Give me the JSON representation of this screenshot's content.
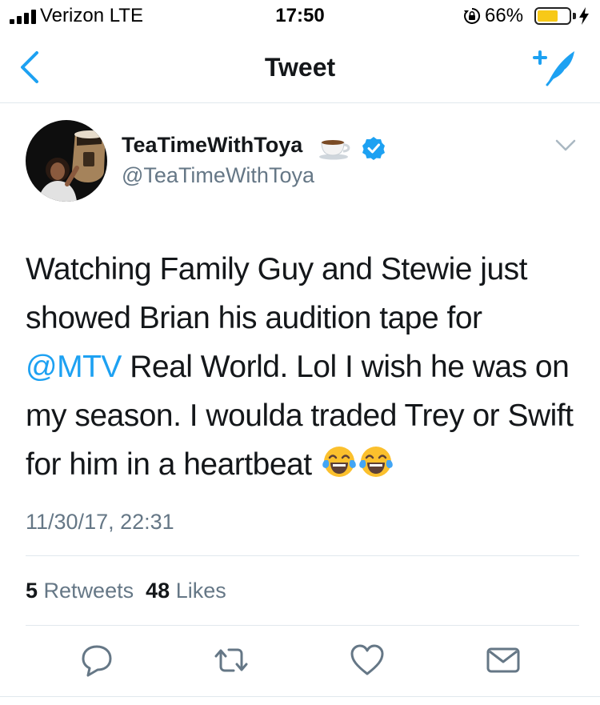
{
  "status_bar": {
    "carrier": "Verizon  LTE",
    "time": "17:50",
    "battery_percent_label": "66%",
    "battery_level": 0.66,
    "icons": [
      "signal-bars-icon",
      "orientation-lock-icon",
      "battery-icon",
      "charging-bolt-icon"
    ]
  },
  "nav": {
    "title": "Tweet",
    "icons": [
      "back-chevron-icon",
      "compose-tweet-icon"
    ]
  },
  "tweet": {
    "author": {
      "display_name": "TeaTimeWithToya",
      "handle": "@TeaTimeWithToya",
      "icons": [
        "teacup-emoji-icon",
        "verified-badge-icon",
        "chevron-down-icon"
      ]
    },
    "text": {
      "part1": "Watching Family Guy and Stewie just showed Brian his audition tape for ",
      "mention": "@MTV",
      "part2": " Real World. Lol I wish he was on my season. I woulda traded Trey or Swift for him in a heartbeat",
      "emojis": [
        "tears-of-joy-emoji",
        "tears-of-joy-emoji"
      ]
    },
    "timestamp": "11/30/17, 22:31",
    "stats": {
      "retweets_count": "5",
      "retweets_label": "Retweets",
      "likes_count": "48",
      "likes_label": "Likes"
    },
    "actions": [
      "reply-icon",
      "retweet-icon",
      "like-heart-icon",
      "share-envelope-icon"
    ]
  },
  "colors": {
    "accent": "#1da1f2",
    "text_primary": "#14171a",
    "text_secondary": "#657786",
    "divider": "#e1e8ed",
    "battery": "#f7c918"
  }
}
